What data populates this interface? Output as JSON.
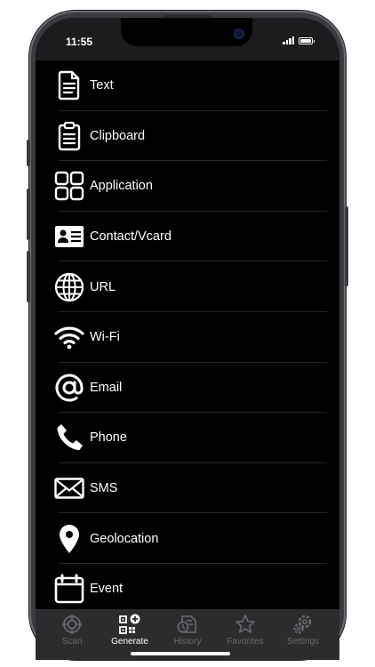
{
  "status_bar": {
    "time": "11:55"
  },
  "generate_list": [
    {
      "label": "Text",
      "icon": "text-document-icon"
    },
    {
      "label": "Clipboard",
      "icon": "clipboard-icon"
    },
    {
      "label": "Application",
      "icon": "app-grid-icon"
    },
    {
      "label": "Contact/Vcard",
      "icon": "contact-card-icon"
    },
    {
      "label": "URL",
      "icon": "globe-icon"
    },
    {
      "label": "Wi-Fi",
      "icon": "wifi-icon"
    },
    {
      "label": "Email",
      "icon": "at-sign-icon"
    },
    {
      "label": "Phone",
      "icon": "phone-icon"
    },
    {
      "label": "SMS",
      "icon": "envelope-icon"
    },
    {
      "label": "Geolocation",
      "icon": "map-pin-icon"
    },
    {
      "label": "Event",
      "icon": "calendar-icon"
    }
  ],
  "tabbar": {
    "scan": "Scan",
    "generate": "Generate",
    "history": "History",
    "favorites": "Favorites",
    "settings": "Settings",
    "active": "Generate"
  },
  "colors": {
    "background": "#000000",
    "tabbar": "#2c2c2e",
    "inactive_tab": "#6b6b70",
    "active_tab": "#ffffff"
  }
}
